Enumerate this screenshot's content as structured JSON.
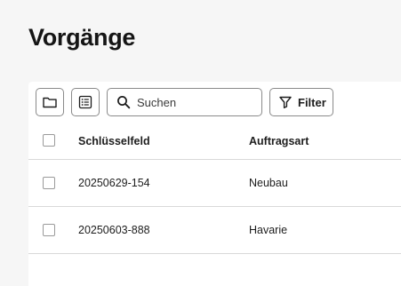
{
  "page": {
    "title": "Vorgänge"
  },
  "toolbar": {
    "folder_button_icon": "folder-icon",
    "list_button_icon": "list-icon",
    "search": {
      "icon": "search-icon",
      "placeholder": "Suchen",
      "value": ""
    },
    "filter": {
      "icon": "filter-icon",
      "label": "Filter"
    }
  },
  "table": {
    "columns": [
      "Schlüsselfeld",
      "Auftragsart"
    ],
    "rows": [
      {
        "schluesselfeld": "20250629-154",
        "auftragsart": "Neubau"
      },
      {
        "schluesselfeld": "20250603-888",
        "auftragsart": "Havarie"
      }
    ]
  },
  "colors": {
    "background": "#f6f6f6",
    "card": "#ffffff",
    "border": "#8a8a8a",
    "divider": "#d9d9d9",
    "text": "#1d1d1d"
  }
}
